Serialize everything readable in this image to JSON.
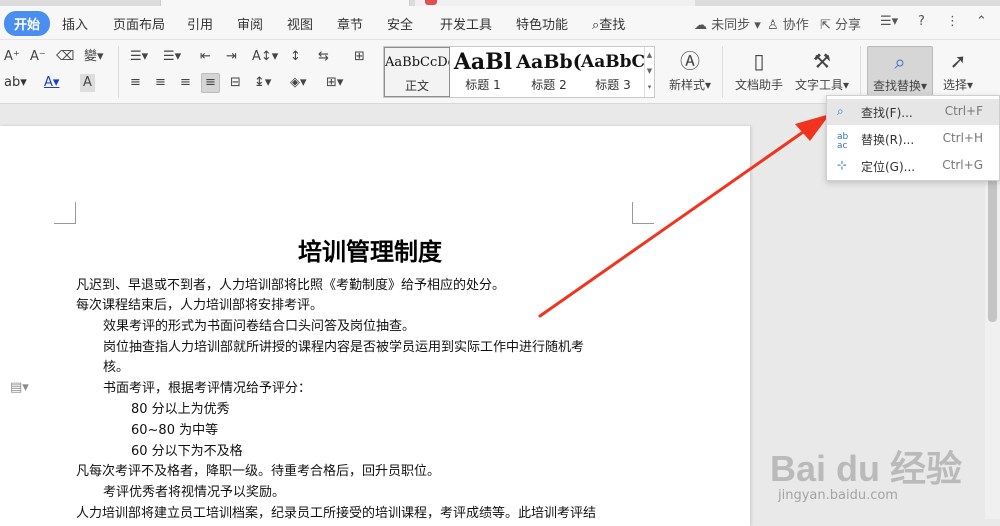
{
  "menu": {
    "items": [
      "开始",
      "插入",
      "页面布局",
      "引用",
      "审阅",
      "视图",
      "章节",
      "安全",
      "开发工具",
      "特色功能",
      "查找"
    ],
    "sync": "未同步",
    "collab": "协作",
    "share": "分享"
  },
  "ribbon": {
    "styles": [
      {
        "preview": "AaBbCcDd",
        "label": "正文"
      },
      {
        "preview": "AaBl",
        "label": "标题 1"
      },
      {
        "preview": "AaBb(",
        "label": "标题 2"
      },
      {
        "preview": "AaBbC",
        "label": "标题 3"
      }
    ],
    "new_style": "新样式",
    "doc_helper": "文档助手",
    "text_tools": "文字工具",
    "find_replace": "查找替换",
    "select": "选择"
  },
  "dropdown": {
    "items": [
      {
        "label": "查找(F)...",
        "shortcut": "Ctrl+F",
        "icon": "search-icon"
      },
      {
        "label": "替换(R)...",
        "shortcut": "Ctrl+H",
        "icon": "replace-icon"
      },
      {
        "label": "定位(G)...",
        "shortcut": "Ctrl+G",
        "icon": "goto-icon"
      }
    ]
  },
  "document": {
    "title": "培训管理制度",
    "lines": [
      "凡迟到、早退或不到者，人力培训部将比照《考勤制度》给予相应的处分。",
      "每次课程结束后，人力培训部将安排考评。",
      "效果考评的形式为书面问卷结合口头问答及岗位抽查。",
      "岗位抽查指人力培训部就所讲授的课程内容是否被学员运用到实际工作中进行随机考",
      "核。",
      "书面考评，根据考评情况给予评分：",
      "80 分以上为优秀",
      "60~80 为中等",
      "60 分以下为不及格",
      "凡每次考评不及格者，降职一级。待重考合格后，回升员职位。",
      "考评优秀者将视情况予以奖励。",
      "人力培训部将建立员工培训档案，纪录员工所接受的培训课程，考评成绩等。此培训考评结"
    ]
  },
  "watermark": {
    "brand": "Bai du 经验",
    "url": "jingyan.baidu.com"
  }
}
